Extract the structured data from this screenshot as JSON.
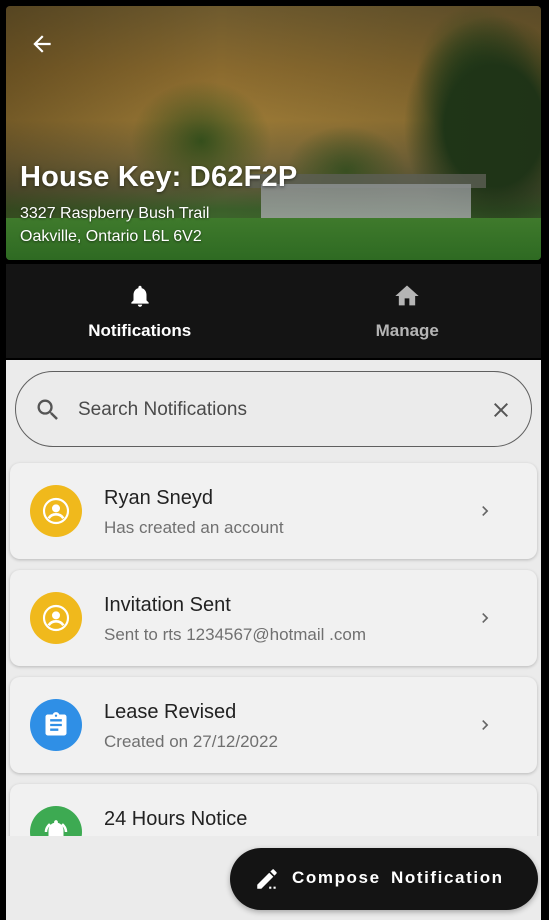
{
  "header": {
    "title": "House Key: D62F2P",
    "address_line1": "3327 Raspberry  Bush  Trail",
    "address_line2": "Oakville, Ontario  L6L 6V2",
    "back_icon": "arrow-left-icon"
  },
  "tabs": [
    {
      "label": "Notifications",
      "icon": "bell-icon",
      "active": true
    },
    {
      "label": "Manage",
      "icon": "home-icon",
      "active": false
    }
  ],
  "search": {
    "placeholder": "Search Notifications",
    "value": ""
  },
  "notifications": [
    {
      "title": "Ryan Sneyd",
      "subtitle": "Has created  an account",
      "icon": "user-icon",
      "color": "#F0B91C"
    },
    {
      "title": "Invitation Sent",
      "subtitle": "Sent  to rts 1234567@hotmail .com",
      "icon": "user-icon",
      "color": "#F0B91C"
    },
    {
      "title": "Lease Revised",
      "subtitle": "Created  on 27/12/2022",
      "icon": "clipboard-icon",
      "color": "#2F8FE6"
    },
    {
      "title": "24 Hours Notice",
      "subtitle": "",
      "icon": "alarm-icon",
      "color": "#3DAA52"
    }
  ],
  "compose": {
    "label": "Compose  Notification",
    "icon": "pen-icon"
  }
}
